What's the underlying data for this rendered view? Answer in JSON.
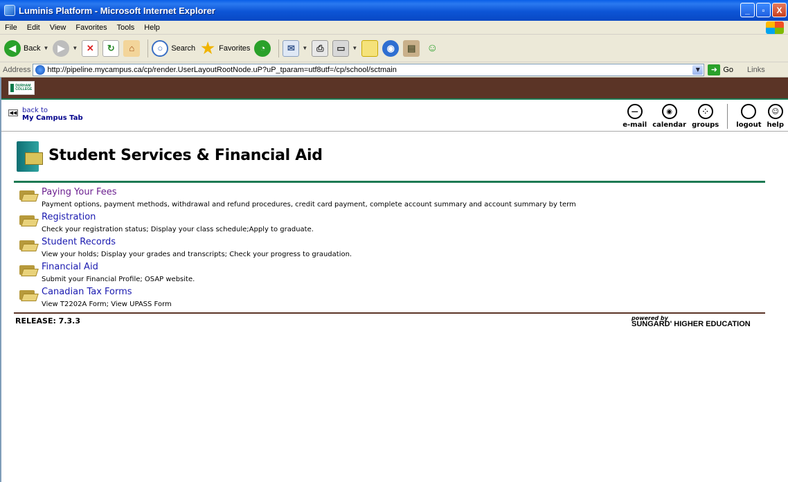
{
  "window": {
    "title": "Luminis Platform - Microsoft Internet Explorer",
    "buttons": {
      "minimize": "_",
      "maximize": "▫",
      "close": "X"
    }
  },
  "menu": [
    "File",
    "Edit",
    "View",
    "Favorites",
    "Tools",
    "Help"
  ],
  "toolbar": {
    "back": "Back",
    "search": "Search",
    "favorites": "Favorites"
  },
  "address": {
    "label": "Address",
    "url": "http://pipeline.mycampus.ca/cp/render.UserLayoutRootNode.uP?uP_tparam=utf8utf=/cp/school/sctmain",
    "go": "Go",
    "links": "Links"
  },
  "brand": {
    "logo_text": "DURHAM COLLEGE"
  },
  "nav": {
    "back_line1": "back to",
    "back_line2": "My Campus Tab",
    "icons": [
      {
        "label": "e-mail",
        "icon": "email-icon"
      },
      {
        "label": "calendar",
        "icon": "calendar-icon"
      },
      {
        "label": "groups",
        "icon": "groups-icon"
      },
      {
        "label": "logout",
        "icon": "logout-icon"
      },
      {
        "label": "help",
        "icon": "help-icon"
      }
    ]
  },
  "page": {
    "title": "Student Services & Financial Aid",
    "items": [
      {
        "title": "Paying Your Fees",
        "desc": "Payment options, payment methods, withdrawal and refund procedures, credit card payment, complete account summary and account summary by term",
        "visited": true
      },
      {
        "title": "Registration",
        "desc": "Check your registration status; Display your class schedule;Apply to graduate.",
        "visited": false
      },
      {
        "title": "Student Records",
        "desc": "View your holds; Display your grades and transcripts; Check your progress to graudation.",
        "visited": false
      },
      {
        "title": "Financial Aid",
        "desc": "Submit your Financial Profile; OSAP website.",
        "visited": false
      },
      {
        "title": "Canadian Tax Forms",
        "desc": "View T2202A Form; View UPASS Form",
        "visited": false
      }
    ],
    "release": "RELEASE: 7.3.3",
    "powered_by": "powered by",
    "sungard": "SUNGARD' HIGHER EDUCATION"
  }
}
